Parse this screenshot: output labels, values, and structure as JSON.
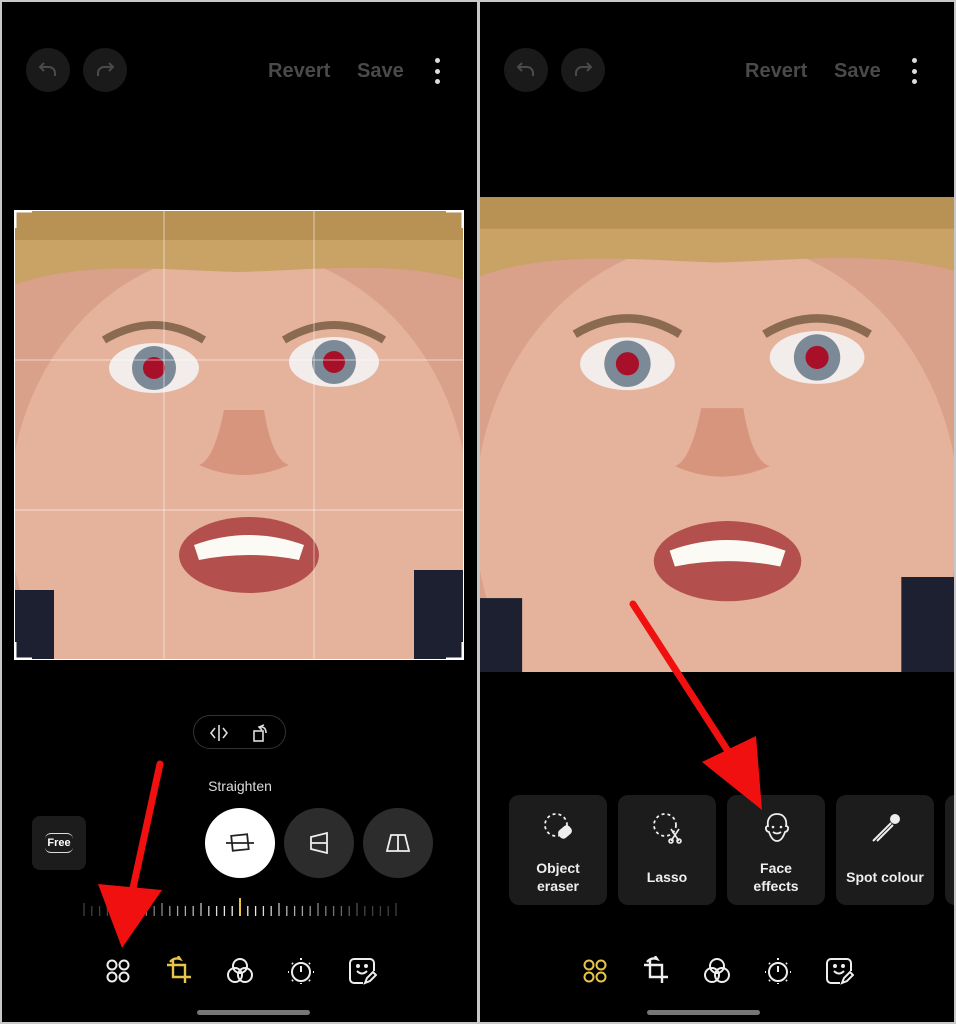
{
  "colors": {
    "accent": "#e8c547",
    "arrow": "#f01010",
    "disabled": "#4a4a4a"
  },
  "left": {
    "topbar": {
      "undo_icon": "undo-icon",
      "redo_icon": "redo-icon",
      "revert": "Revert",
      "save": "Save",
      "more_icon": "kebab-icon"
    },
    "crop_controls": {
      "flip_icon": "flip-icon",
      "rotate_icon": "rotate-icon"
    },
    "mode_label": "Straighten",
    "free_label": "Free",
    "modes": [
      {
        "icon": "straighten-icon",
        "selected": true
      },
      {
        "icon": "vertical-perspective-icon"
      },
      {
        "icon": "horizontal-perspective-icon"
      }
    ],
    "ruler_value": 0,
    "toolbar": [
      {
        "icon": "tools-grid-icon"
      },
      {
        "icon": "crop-rotate-icon",
        "selected": true
      },
      {
        "icon": "filters-icon"
      },
      {
        "icon": "brightness-icon"
      },
      {
        "icon": "sticker-icon"
      }
    ]
  },
  "right": {
    "topbar": {
      "undo_icon": "undo-icon",
      "redo_icon": "redo-icon",
      "revert": "Revert",
      "save": "Save",
      "more_icon": "kebab-icon"
    },
    "tools": [
      {
        "icon": "object-eraser-icon",
        "line1": "Object",
        "line2": "eraser"
      },
      {
        "icon": "lasso-icon",
        "label": "Lasso"
      },
      {
        "icon": "face-icon",
        "line1": "Face",
        "line2": "effects"
      },
      {
        "icon": "eyedropper-icon",
        "label": "Spot colour"
      }
    ],
    "toolbar": [
      {
        "icon": "tools-grid-icon",
        "selected": true
      },
      {
        "icon": "crop-rotate-icon"
      },
      {
        "icon": "filters-icon"
      },
      {
        "icon": "brightness-icon"
      },
      {
        "icon": "sticker-icon"
      }
    ]
  }
}
